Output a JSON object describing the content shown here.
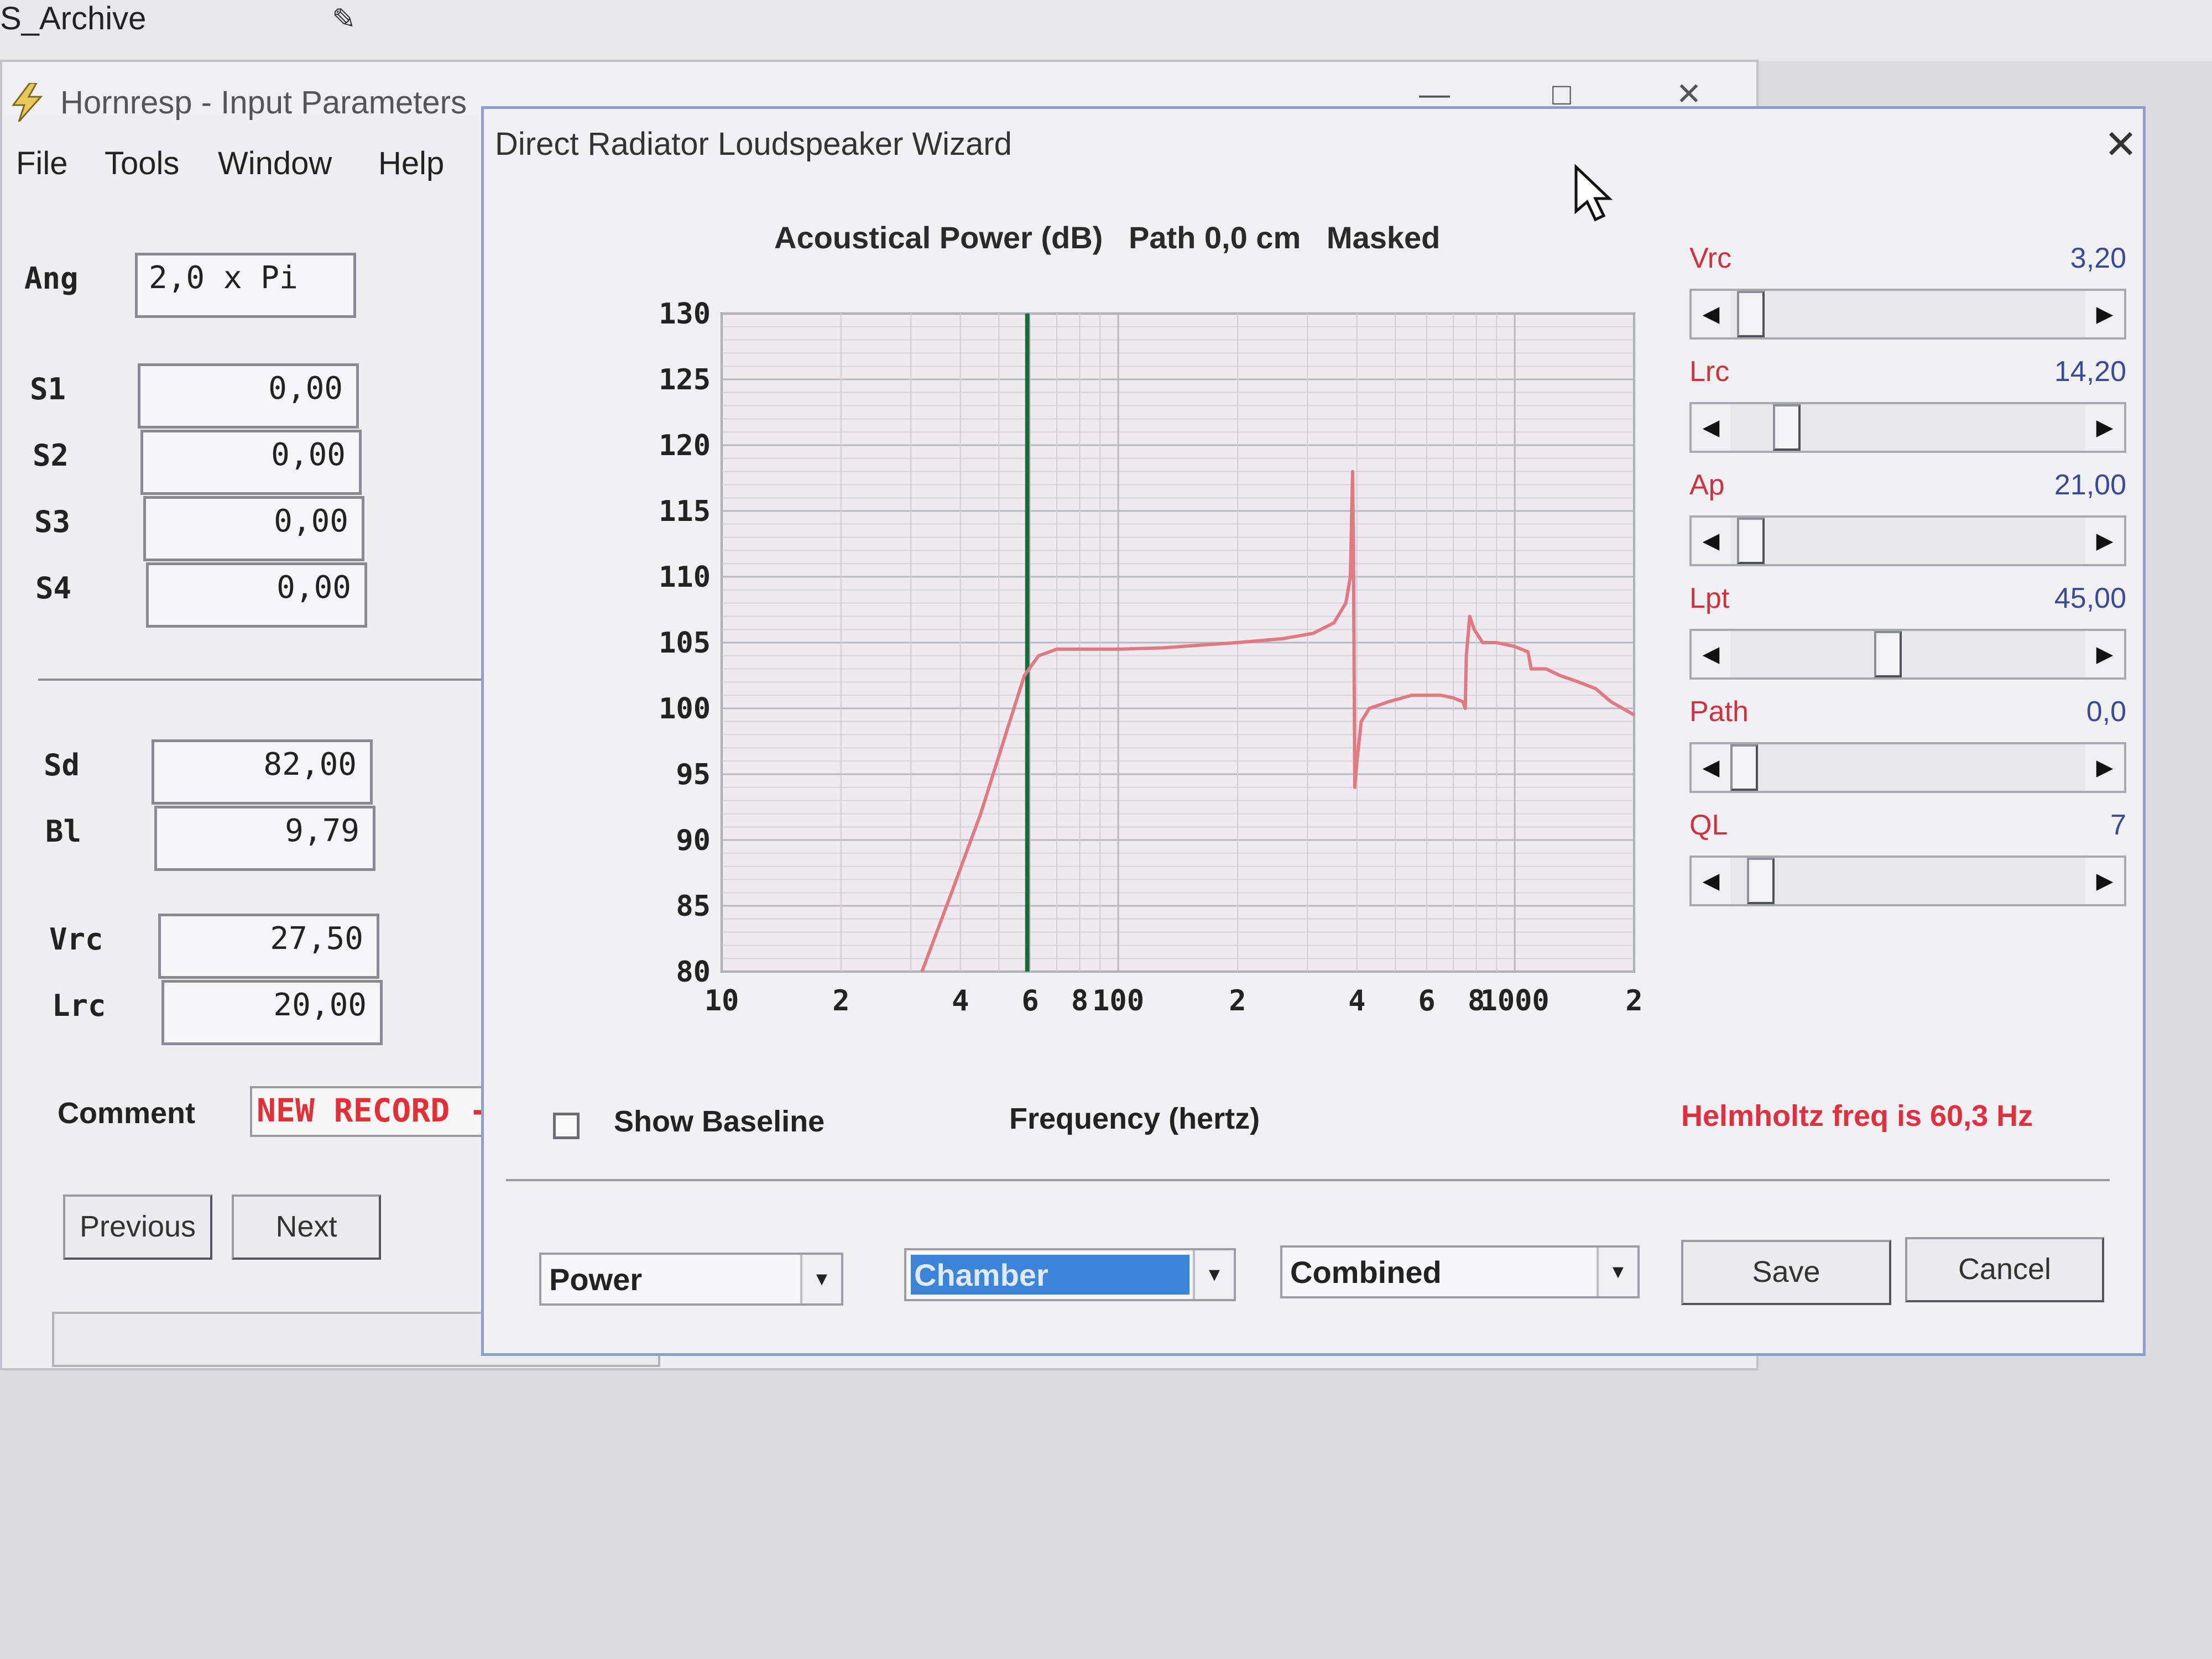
{
  "taskbar": {
    "title": "S_Archive"
  },
  "main_window": {
    "title": "Hornresp - Input Parameters",
    "menu": [
      "File",
      "Tools",
      "Window",
      "Help"
    ],
    "params": [
      {
        "label": "Ang",
        "value": "2,0 x Pi"
      },
      {
        "label": "S1",
        "value": "0,00"
      },
      {
        "label": "S2",
        "value": "0,00"
      },
      {
        "label": "S3",
        "value": "0,00"
      },
      {
        "label": "S4",
        "value": "0,00"
      },
      {
        "label": "Sd",
        "value": "82,00"
      },
      {
        "label": "Bl",
        "value": "9,79"
      },
      {
        "label": "Vrc",
        "value": "27,50"
      },
      {
        "label": "Lrc",
        "value": "20,00"
      }
    ],
    "comment_label": "Comment",
    "comment_value": "NEW RECORD -",
    "previous_label": "Previous",
    "next_label": "Next"
  },
  "wizard": {
    "title": "Direct Radiator Loudspeaker Wizard",
    "chart_header": "Acoustical Power (dB)   Path 0,0 cm   Masked",
    "sliders": [
      {
        "label": "Vrc",
        "value": "3,20",
        "pos": 0.02
      },
      {
        "label": "Lrc",
        "value": "14,20",
        "pos": 0.13
      },
      {
        "label": "Ap",
        "value": "21,00",
        "pos": 0.02
      },
      {
        "label": "Lpt",
        "value": "45,00",
        "pos": 0.44
      },
      {
        "label": "Path",
        "value": "0,0",
        "pos": 0.0
      },
      {
        "label": "QL",
        "value": "7",
        "pos": 0.05
      }
    ],
    "show_baseline_label": "Show Baseline",
    "helmholtz_text": "Helmholtz freq is 60,3 Hz",
    "selects": {
      "power": "Power",
      "chamber": "Chamber",
      "combined": "Combined"
    },
    "save_label": "Save",
    "cancel_label": "Cancel"
  },
  "chart_data": {
    "type": "line",
    "title": "Acoustical Power (dB)",
    "xlabel": "Frequency (hertz)",
    "ylabel": "",
    "xscale": "log",
    "xlim": [
      10,
      2000
    ],
    "ylim": [
      80,
      130
    ],
    "yticks": [
      80,
      85,
      90,
      95,
      100,
      105,
      110,
      115,
      120,
      125,
      130
    ],
    "xtick_labels": [
      {
        "x": 10,
        "label": "10"
      },
      {
        "x": 20,
        "label": "2"
      },
      {
        "x": 40,
        "label": "4"
      },
      {
        "x": 60,
        "label": "6"
      },
      {
        "x": 80,
        "label": "8"
      },
      {
        "x": 100,
        "label": "100"
      },
      {
        "x": 200,
        "label": "2"
      },
      {
        "x": 400,
        "label": "4"
      },
      {
        "x": 600,
        "label": "6"
      },
      {
        "x": 800,
        "label": "8"
      },
      {
        "x": 1000,
        "label": "1000"
      },
      {
        "x": 2000,
        "label": "2"
      }
    ],
    "marker_x": 59,
    "series": [
      {
        "color": "#e07a80",
        "points": [
          [
            32,
            80
          ],
          [
            38,
            86
          ],
          [
            45,
            92
          ],
          [
            52,
            98
          ],
          [
            58,
            102.5
          ],
          [
            63,
            104
          ],
          [
            70,
            104.5
          ],
          [
            80,
            104.5
          ],
          [
            100,
            104.5
          ],
          [
            130,
            104.6
          ],
          [
            160,
            104.8
          ],
          [
            200,
            105
          ],
          [
            260,
            105.3
          ],
          [
            310,
            105.7
          ],
          [
            350,
            106.5
          ],
          [
            375,
            108
          ],
          [
            385,
            110
          ],
          [
            390,
            118
          ],
          [
            392,
            112
          ],
          [
            395,
            94
          ],
          [
            400,
            96
          ],
          [
            410,
            99
          ],
          [
            430,
            100
          ],
          [
            480,
            100.5
          ],
          [
            550,
            101
          ],
          [
            650,
            101
          ],
          [
            700,
            100.8
          ],
          [
            740,
            100.5
          ],
          [
            750,
            100
          ],
          [
            755,
            104
          ],
          [
            770,
            107
          ],
          [
            790,
            106
          ],
          [
            830,
            105
          ],
          [
            900,
            105
          ],
          [
            1000,
            104.7
          ],
          [
            1080,
            104.3
          ],
          [
            1100,
            103
          ],
          [
            1200,
            103
          ],
          [
            1300,
            102.5
          ],
          [
            1450,
            102
          ],
          [
            1600,
            101.5
          ],
          [
            1750,
            100.5
          ],
          [
            2000,
            99.5
          ]
        ]
      }
    ],
    "grid": true
  }
}
